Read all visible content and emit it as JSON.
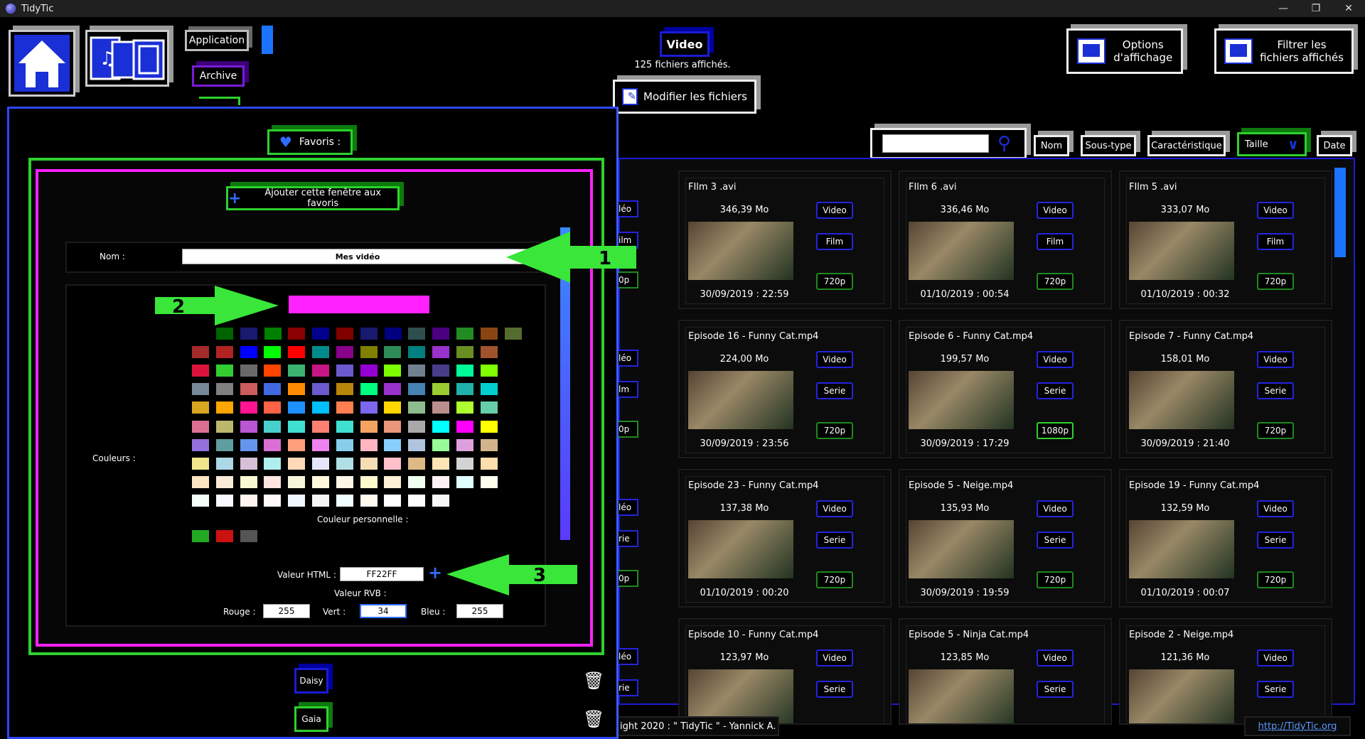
{
  "app": {
    "title": "TidyTic"
  },
  "toolbar": {
    "application": "Application",
    "archive": "Archive",
    "video": "Video",
    "count": "125 fichiers affichés.",
    "modify": "Modifier les fichiers",
    "options": "Options\nd'affichage",
    "filter": "Filtrer les\nfichiers affichés"
  },
  "sort": {
    "search_value": "",
    "nom": "Nom",
    "soustype": "Sous-type",
    "caract": "Caractéristique",
    "taille": "Taille",
    "date": "Date"
  },
  "tiles": [
    {
      "name": "FIlm 3 .avi",
      "size": "346,39 Mo",
      "date": "30/09/2019 : 22:59",
      "type": "Video",
      "sub": "Film",
      "res": "720p"
    },
    {
      "name": "FIlm 6 .avi",
      "size": "336,46 Mo",
      "date": "01/10/2019 : 00:54",
      "type": "Video",
      "sub": "Film",
      "res": "720p"
    },
    {
      "name": "FIlm 5 .avi",
      "size": "333,07 Mo",
      "date": "01/10/2019 : 00:32",
      "type": "Video",
      "sub": "Film",
      "res": "720p"
    },
    {
      "name": "Episode 16 - Funny Cat.mp4",
      "size": "224,00 Mo",
      "date": "30/09/2019 : 23:56",
      "type": "Video",
      "sub": "Serie",
      "res": "720p"
    },
    {
      "name": "Episode 6 - Funny Cat.mp4",
      "size": "199,57 Mo",
      "date": "30/09/2019 : 17:29",
      "type": "Video",
      "sub": "Serie",
      "res": "1080p"
    },
    {
      "name": "Episode 7 - Funny Cat.mp4",
      "size": "158,01 Mo",
      "date": "30/09/2019 : 21:40",
      "type": "Video",
      "sub": "Serie",
      "res": "720p"
    },
    {
      "name": "Episode 23 - Funny Cat.mp4",
      "size": "137,38 Mo",
      "date": "01/10/2019 : 00:20",
      "type": "Video",
      "sub": "Serie",
      "res": "720p"
    },
    {
      "name": "Episode 5 - Neige.mp4",
      "size": "135,93 Mo",
      "date": "30/09/2019 : 19:59",
      "type": "Video",
      "sub": "Serie",
      "res": "720p"
    },
    {
      "name": "Episode 19 - Funny Cat.mp4",
      "size": "132,59 Mo",
      "date": "01/10/2019 : 00:07",
      "type": "Video",
      "sub": "Serie",
      "res": "720p"
    },
    {
      "name": "Episode 10 - Funny Cat.mp4",
      "size": "123,97 Mo",
      "date": "",
      "type": "Video",
      "sub": "Serie",
      "res": ""
    },
    {
      "name": "Episode 5 - Ninja Cat.mp4",
      "size": "123,85 Mo",
      "date": "",
      "type": "Video",
      "sub": "Serie",
      "res": ""
    },
    {
      "name": "Episode 2 - Neige.mp4",
      "size": "121,36 Mo",
      "date": "",
      "type": "Video",
      "sub": "Serie",
      "res": ""
    }
  ],
  "left_tags": [
    {
      "a": "léo",
      "b": "ilm",
      "c": "0p"
    },
    {
      "a": "léo",
      "b": "lm",
      "c": "0p"
    },
    {
      "a": "léo",
      "b": "rie",
      "c": "0p"
    },
    {
      "a": "léo",
      "b": "rie",
      "c": ""
    }
  ],
  "footer": {
    "copyright": "ight 2020 : \" TidyTic \" - Yannick A.",
    "link": "http://TidyTic.org"
  },
  "panel": {
    "favoris": "Favoris :",
    "add_fav": "Ajouter cette fenêtre aux favoris",
    "nom_label": "Nom :",
    "nom_value": "Mes vidéo",
    "couleurs_label": "Couleurs :",
    "perso_label": "Couleur personnelle :",
    "html_label": "Valeur HTML :",
    "html_value": "FF22FF",
    "rvb_label": "Valeur RVB :",
    "rouge_label": "Rouge :",
    "rouge": "255",
    "vert_label": "Vert :",
    "vert": "34",
    "bleu_label": "Bleu :",
    "bleu": "255",
    "preview_color": "#ff22ff",
    "arrows": [
      "1",
      "2",
      "3"
    ],
    "favorites": [
      {
        "name": "Daisy",
        "color": "#1b1bd6"
      },
      {
        "name": "Gaia",
        "color": "#2ed12e"
      }
    ]
  },
  "palette": {
    "rows": [
      [
        "#006400",
        "#191970",
        "#008000",
        "#8b0000",
        "#00008b",
        "#800000",
        "#191970",
        "#000080",
        "#2f4f4f",
        "#4b0082",
        "#228b22",
        "#8b4513",
        "#556b2f"
      ],
      [
        "#a52a2a",
        "#b22222",
        "#0000ff",
        "#00ff00",
        "#ff0000",
        "#008b8b",
        "#8b008b",
        "#808000",
        "#2e8b57",
        "#008080",
        "#9932cc",
        "#6b8e23",
        "#a0522d"
      ],
      [
        "#dc143c",
        "#32cd32",
        "#696969",
        "#ff4500",
        "#3cb371",
        "#c71585",
        "#6a5acd",
        "#9400d3",
        "#7cfc00",
        "#708090",
        "#483d8b",
        "#00fa9a",
        "#7fff00"
      ],
      [
        "#778899",
        "#808080",
        "#cd5c5c",
        "#4169e1",
        "#ff8c00",
        "#6a5acd",
        "#b8860b",
        "#00ff7f",
        "#9932cc",
        "#4682b4",
        "#9acd32",
        "#20b2aa",
        "#00ced1"
      ],
      [
        "#daa520",
        "#ffa500",
        "#ff1493",
        "#ff6347",
        "#1e90ff",
        "#00bfff",
        "#ff7f50",
        "#7b68ee",
        "#ffd700",
        "#8fbc8f",
        "#bc8f8f",
        "#adff2f",
        "#66cdaa"
      ],
      [
        "#db7093",
        "#bdb76b",
        "#ba55d3",
        "#48d1cc",
        "#40e0d0",
        "#fa8072",
        "#40e0d0",
        "#f4a460",
        "#e9967a",
        "#a9a9a9",
        "#00ffff",
        "#ff00ff",
        "#ffff00"
      ],
      [
        "#9370db",
        "#5f9ea0",
        "#6495ed",
        "#da70d6",
        "#ffa07a",
        "#ee82ee",
        "#87ceeb",
        "#ffb6c1",
        "#87cefa",
        "#b0c4de",
        "#98fb98",
        "#dda0dd",
        "#d2b48c"
      ],
      [
        "#f0e68c",
        "#add8e6",
        "#d8bfd8",
        "#afeeee",
        "#ffdab9",
        "#e6e6fa",
        "#b0e0e6",
        "#f5deb3",
        "#ffc0cb",
        "#deb887",
        "#ffe4b5",
        "#d3d3d3",
        "#ffdead"
      ],
      [
        "#ffe4c4",
        "#faebd7",
        "#fafad2",
        "#ffe4e1",
        "#f5f5dc",
        "#fff8dc",
        "#fdf5e6",
        "#fffacd",
        "#ffefd5",
        "#f0fff0",
        "#fff0f5",
        "#e0ffff",
        "#fffff0"
      ],
      [
        "#f5fffa",
        "#f8f8ff",
        "#fff5ee",
        "#fffafa",
        "#f0f8ff",
        "#f5f5f5",
        "#f0ffff",
        "#fffaf0",
        "#ffffff",
        "#fdfdfd",
        "#f7f7f7"
      ]
    ],
    "custom": [
      "#22aa22",
      "#cc1111",
      "#555555"
    ]
  }
}
